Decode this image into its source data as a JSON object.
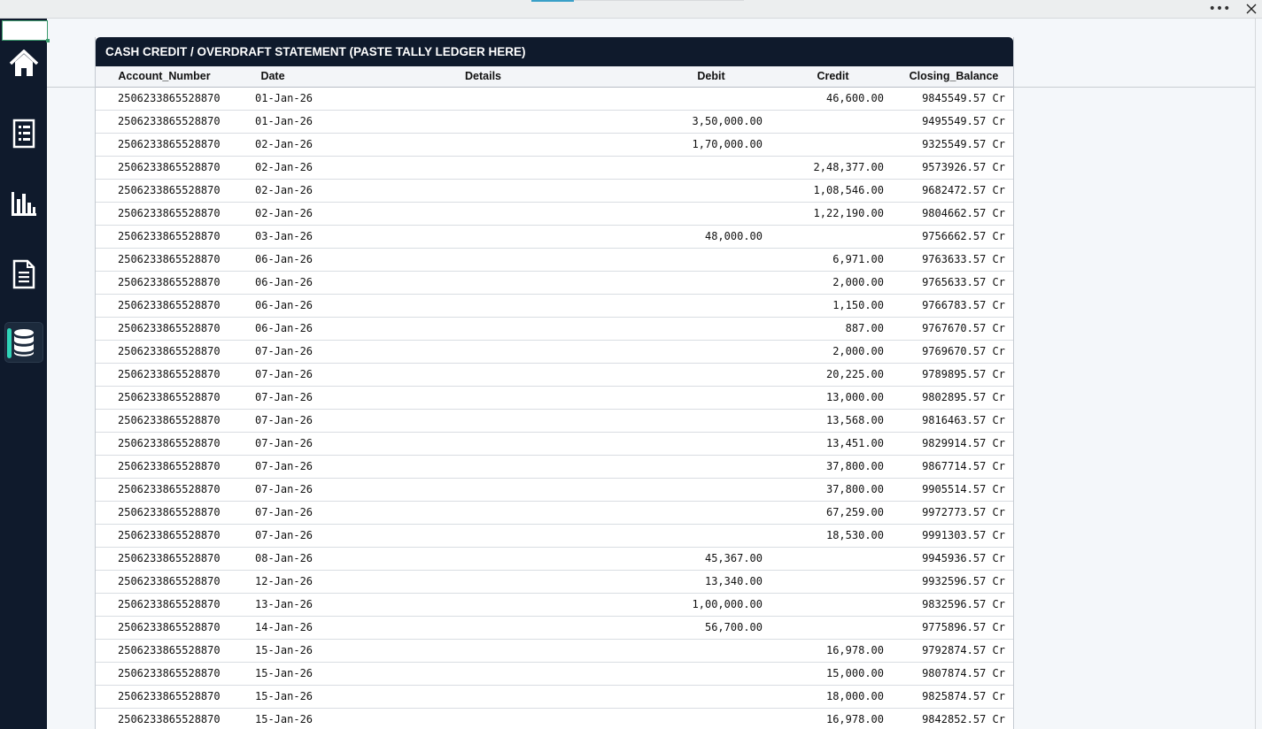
{
  "window": {
    "more_glyph": "•••",
    "icons": {
      "more": "more-dots-icon",
      "close": "close-icon"
    }
  },
  "sidebar": {
    "items": [
      {
        "name": "home",
        "icon": "home-icon",
        "active": false
      },
      {
        "name": "ledger",
        "icon": "ledger-list-icon",
        "active": false
      },
      {
        "name": "reports",
        "icon": "bar-chart-icon",
        "active": false
      },
      {
        "name": "documents",
        "icon": "document-icon",
        "active": false
      },
      {
        "name": "database",
        "icon": "database-icon",
        "active": true
      }
    ],
    "colors": {
      "background": "#0f1a2c",
      "active_accent": "#2fd3b8"
    }
  },
  "table": {
    "title": "CASH CREDIT / OVERDRAFT STATEMENT (PASTE TALLY LEDGER HERE)",
    "columns": {
      "account": "Account_Number",
      "date": "Date",
      "details": "Details",
      "debit": "Debit",
      "credit": "Credit",
      "balance": "Closing_Balance"
    },
    "rows": [
      {
        "account": "2506233865528870",
        "date": "01-Jan-26",
        "details": "",
        "debit": "",
        "credit": "46,600.00",
        "balance": "9845549.57 Cr"
      },
      {
        "account": "2506233865528870",
        "date": "01-Jan-26",
        "details": "",
        "debit": "3,50,000.00",
        "credit": "",
        "balance": "9495549.57 Cr"
      },
      {
        "account": "2506233865528870",
        "date": "02-Jan-26",
        "details": "",
        "debit": "1,70,000.00",
        "credit": "",
        "balance": "9325549.57 Cr"
      },
      {
        "account": "2506233865528870",
        "date": "02-Jan-26",
        "details": "",
        "debit": "",
        "credit": "2,48,377.00",
        "balance": "9573926.57 Cr"
      },
      {
        "account": "2506233865528870",
        "date": "02-Jan-26",
        "details": "",
        "debit": "",
        "credit": "1,08,546.00",
        "balance": "9682472.57 Cr"
      },
      {
        "account": "2506233865528870",
        "date": "02-Jan-26",
        "details": "",
        "debit": "",
        "credit": "1,22,190.00",
        "balance": "9804662.57 Cr"
      },
      {
        "account": "2506233865528870",
        "date": "03-Jan-26",
        "details": "",
        "debit": "48,000.00",
        "credit": "",
        "balance": "9756662.57 Cr"
      },
      {
        "account": "2506233865528870",
        "date": "06-Jan-26",
        "details": "",
        "debit": "",
        "credit": "6,971.00",
        "balance": "9763633.57 Cr"
      },
      {
        "account": "2506233865528870",
        "date": "06-Jan-26",
        "details": "",
        "debit": "",
        "credit": "2,000.00",
        "balance": "9765633.57 Cr"
      },
      {
        "account": "2506233865528870",
        "date": "06-Jan-26",
        "details": "",
        "debit": "",
        "credit": "1,150.00",
        "balance": "9766783.57 Cr"
      },
      {
        "account": "2506233865528870",
        "date": "06-Jan-26",
        "details": "",
        "debit": "",
        "credit": "887.00",
        "balance": "9767670.57 Cr"
      },
      {
        "account": "2506233865528870",
        "date": "07-Jan-26",
        "details": "",
        "debit": "",
        "credit": "2,000.00",
        "balance": "9769670.57 Cr"
      },
      {
        "account": "2506233865528870",
        "date": "07-Jan-26",
        "details": "",
        "debit": "",
        "credit": "20,225.00",
        "balance": "9789895.57 Cr"
      },
      {
        "account": "2506233865528870",
        "date": "07-Jan-26",
        "details": "",
        "debit": "",
        "credit": "13,000.00",
        "balance": "9802895.57 Cr"
      },
      {
        "account": "2506233865528870",
        "date": "07-Jan-26",
        "details": "",
        "debit": "",
        "credit": "13,568.00",
        "balance": "9816463.57 Cr"
      },
      {
        "account": "2506233865528870",
        "date": "07-Jan-26",
        "details": "",
        "debit": "",
        "credit": "13,451.00",
        "balance": "9829914.57 Cr"
      },
      {
        "account": "2506233865528870",
        "date": "07-Jan-26",
        "details": "",
        "debit": "",
        "credit": "37,800.00",
        "balance": "9867714.57 Cr"
      },
      {
        "account": "2506233865528870",
        "date": "07-Jan-26",
        "details": "",
        "debit": "",
        "credit": "37,800.00",
        "balance": "9905514.57 Cr"
      },
      {
        "account": "2506233865528870",
        "date": "07-Jan-26",
        "details": "",
        "debit": "",
        "credit": "67,259.00",
        "balance": "9972773.57 Cr"
      },
      {
        "account": "2506233865528870",
        "date": "07-Jan-26",
        "details": "",
        "debit": "",
        "credit": "18,530.00",
        "balance": "9991303.57 Cr"
      },
      {
        "account": "2506233865528870",
        "date": "08-Jan-26",
        "details": "",
        "debit": "45,367.00",
        "credit": "",
        "balance": "9945936.57 Cr"
      },
      {
        "account": "2506233865528870",
        "date": "12-Jan-26",
        "details": "",
        "debit": "13,340.00",
        "credit": "",
        "balance": "9932596.57 Cr"
      },
      {
        "account": "2506233865528870",
        "date": "13-Jan-26",
        "details": "",
        "debit": "1,00,000.00",
        "credit": "",
        "balance": "9832596.57 Cr"
      },
      {
        "account": "2506233865528870",
        "date": "14-Jan-26",
        "details": "",
        "debit": "56,700.00",
        "credit": "",
        "balance": "9775896.57 Cr"
      },
      {
        "account": "2506233865528870",
        "date": "15-Jan-26",
        "details": "",
        "debit": "",
        "credit": "16,978.00",
        "balance": "9792874.57 Cr"
      },
      {
        "account": "2506233865528870",
        "date": "15-Jan-26",
        "details": "",
        "debit": "",
        "credit": "15,000.00",
        "balance": "9807874.57 Cr"
      },
      {
        "account": "2506233865528870",
        "date": "15-Jan-26",
        "details": "",
        "debit": "",
        "credit": "18,000.00",
        "balance": "9825874.57 Cr"
      },
      {
        "account": "2506233865528870",
        "date": "15-Jan-26",
        "details": "",
        "debit": "",
        "credit": "16,978.00",
        "balance": "9842852.57 Cr"
      }
    ]
  }
}
